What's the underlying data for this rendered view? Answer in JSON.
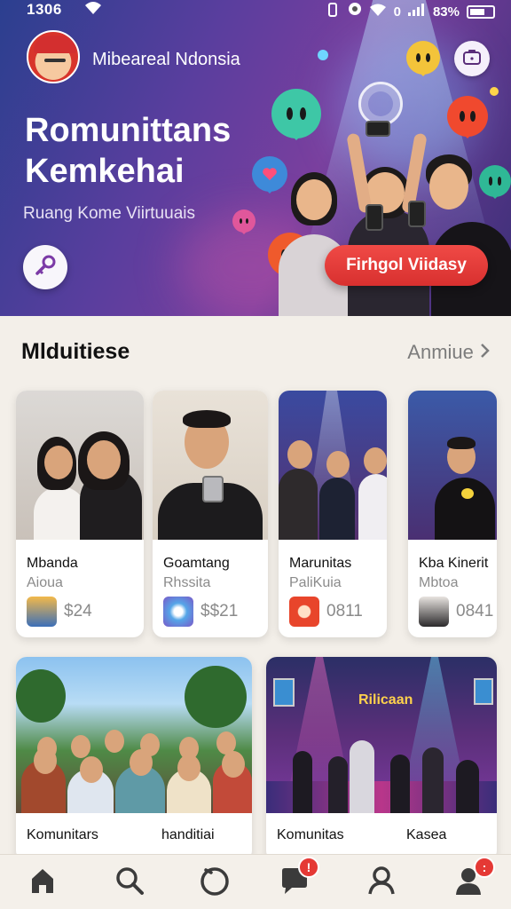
{
  "status_bar": {
    "time": "1306",
    "battery": "83%"
  },
  "header": {
    "user_name": "Mibeareal Ndonsia"
  },
  "hero": {
    "title": "Romunittans Kemkehai",
    "subtitle": "Ruang Kome Viirtuuais",
    "cta_label": "Firhgol Viidasy"
  },
  "section": {
    "title": "Mlduitiese",
    "see_all": "Anmiue"
  },
  "cards_row1": [
    {
      "title": "Mbanda",
      "subtitle": "Aioua",
      "price": "$24"
    },
    {
      "title": "Goamtang",
      "subtitle": "Rhssita",
      "price": "$$21"
    },
    {
      "title": "Marunitas",
      "subtitle": "PaliKuia",
      "price": "0811"
    },
    {
      "title": "Kba Kinerit",
      "subtitle": "Mbtoa",
      "price": "0841"
    }
  ],
  "cards_row2": [
    {
      "title": "Komunitars",
      "subtitle": ""
    },
    {
      "title": "handitiai",
      "subtitle": ""
    },
    {
      "title": "Komunitas",
      "subtitle": ""
    },
    {
      "title": "Kasea",
      "subtitle": ""
    }
  ],
  "scene_text": {
    "venue_sign": "Rilicaan"
  },
  "bottom_nav": {
    "items": [
      "home-icon",
      "search-icon",
      "circle-icon",
      "chat-icon",
      "profile-icon",
      "account-icon"
    ],
    "chat_badge": "!",
    "account_badge": ":"
  },
  "colors": {
    "accent_red": "#e53935",
    "hero_purple": "#5a3e9e",
    "hero_blue": "#2b3f8f"
  }
}
